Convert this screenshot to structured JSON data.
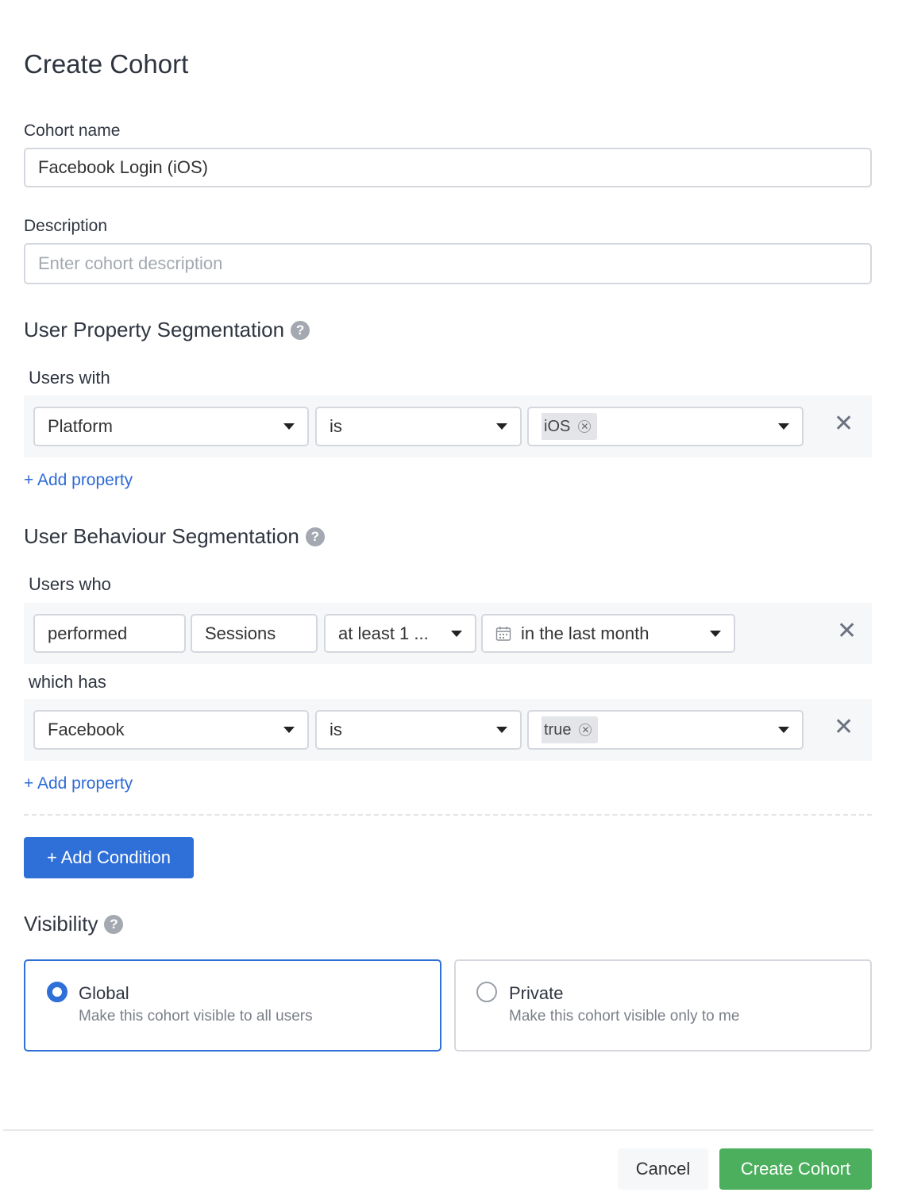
{
  "dialog": {
    "title": "Create Cohort"
  },
  "name_field": {
    "label": "Cohort name",
    "value": "Facebook Login (iOS)"
  },
  "description_field": {
    "label": "Description",
    "placeholder": "Enter cohort description"
  },
  "property_section": {
    "title": "User Property Segmentation",
    "intro": "Users with",
    "row": {
      "property": "Platform",
      "operator": "is",
      "value_chip": "iOS"
    },
    "add_link": "+ Add property"
  },
  "behaviour_section": {
    "title": "User Behaviour Segmentation",
    "intro": "Users who",
    "event_row": {
      "action": "performed",
      "event": "Sessions",
      "frequency": "at least 1 ...",
      "time_range": "in the last month"
    },
    "which_has": "which has",
    "property_row": {
      "property": "Facebook",
      "operator": "is",
      "value_chip": "true"
    },
    "add_link": "+ Add property"
  },
  "add_condition_label": "+ Add Condition",
  "visibility": {
    "title": "Visibility",
    "options": [
      {
        "title": "Global",
        "desc": "Make this cohort visible to all users",
        "selected": true
      },
      {
        "title": "Private",
        "desc": "Make this cohort visible only to me",
        "selected": false
      }
    ]
  },
  "footer": {
    "cancel_label": "Cancel",
    "create_label": "Create Cohort"
  },
  "colors": {
    "primary": "#2f6fd8",
    "success": "#4caf5e",
    "link": "#2e6bd6"
  },
  "icons": {
    "help": "question-circle-icon",
    "remove": "close-icon",
    "calendar": "calendar-icon",
    "dropdown": "caret-down-icon"
  }
}
